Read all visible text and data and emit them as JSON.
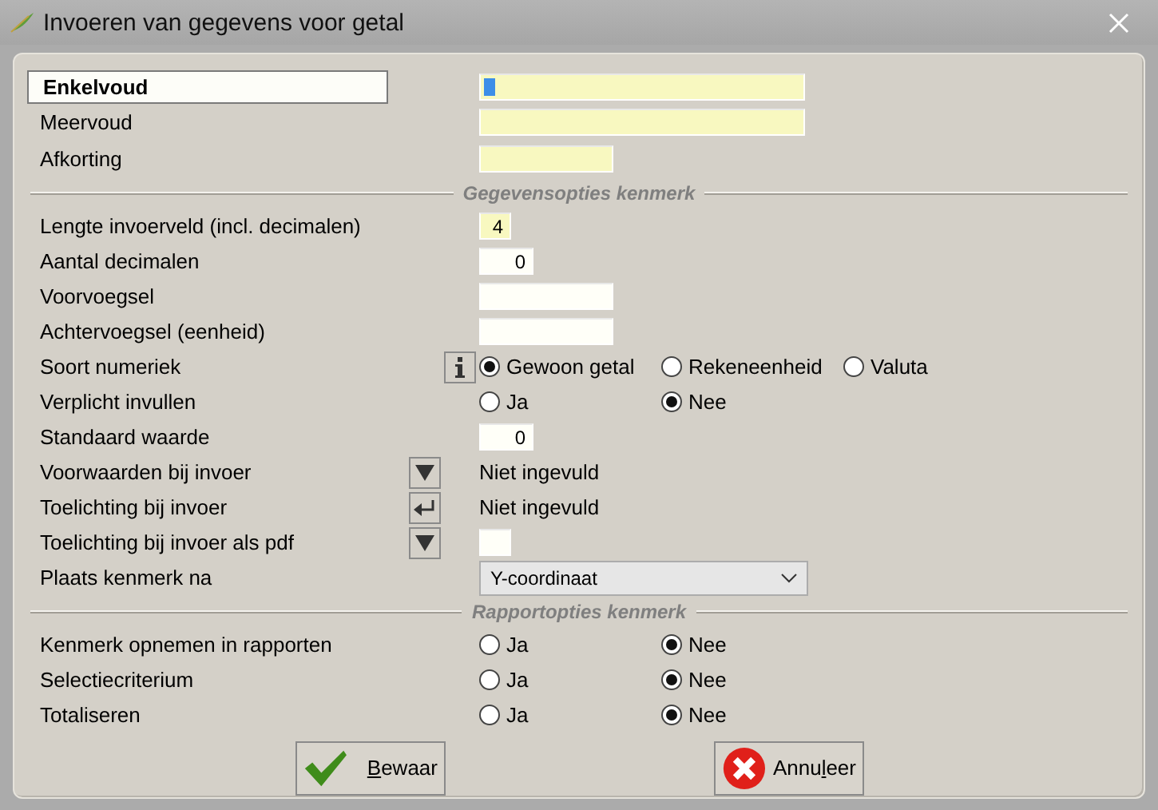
{
  "window": {
    "title": "Invoeren van gegevens voor getal"
  },
  "groups": [
    {
      "rows": [
        {
          "kind": "text",
          "label": "Enkelvoud",
          "focused": true,
          "value": "",
          "highlighted": true
        },
        {
          "kind": "text",
          "label": "Meervoud",
          "focused": false,
          "value": "",
          "highlighted": true
        },
        {
          "kind": "text",
          "label": "Afkorting",
          "focused": false,
          "value": "",
          "highlighted": true
        }
      ]
    },
    {
      "heading": "Gegevensopties kenmerk",
      "rows": [
        {
          "kind": "text",
          "label": "Lengte invoerveld (incl. decimalen)",
          "value": "4",
          "highlighted": true
        },
        {
          "kind": "text",
          "label": "Aantal decimalen",
          "value": "0",
          "highlighted": false
        },
        {
          "kind": "text",
          "label": "Voorvoegsel",
          "value": "",
          "highlighted": false
        },
        {
          "kind": "text",
          "label": "Achtervoegsel (eenheid)",
          "value": "",
          "highlighted": false
        },
        {
          "kind": "radio",
          "label": "Soort numeriek",
          "button": {
            "kind": "info"
          },
          "options": [
            {
              "label": "Gewoon getal",
              "selected": true
            },
            {
              "label": "Rekeneenheid",
              "selected": false
            },
            {
              "label": "Valuta",
              "selected": false
            }
          ]
        },
        {
          "kind": "radio",
          "label": "Verplicht invullen",
          "options": [
            {
              "label": "Ja",
              "selected": false
            },
            {
              "label": "Nee",
              "selected": true
            }
          ]
        },
        {
          "kind": "text",
          "label": "Standaard waarde",
          "value": "0",
          "highlighted": false
        },
        {
          "kind": "note",
          "label": "Voorwaarden bij invoer",
          "button": {
            "kind": "dropdown"
          },
          "value": "Niet ingevuld"
        },
        {
          "kind": "note",
          "label": "Toelichting bij invoer",
          "button": {
            "kind": "return"
          },
          "value": "Niet ingevuld"
        },
        {
          "kind": "text",
          "label": "Toelichting bij invoer als pdf",
          "button": {
            "kind": "dropdown"
          },
          "value": "",
          "highlighted": false
        },
        {
          "kind": "select",
          "label": "Plaats kenmerk na",
          "value": "Y-coordinaat"
        }
      ]
    },
    {
      "heading": "Rapportopties kenmerk",
      "rows": [
        {
          "kind": "radio",
          "label": "Kenmerk opnemen in rapporten",
          "options": [
            {
              "label": "Ja",
              "selected": false
            },
            {
              "label": "Nee",
              "selected": true
            }
          ]
        },
        {
          "kind": "radio",
          "label": "Selectiecriterium",
          "options": [
            {
              "label": "Ja",
              "selected": false
            },
            {
              "label": "Nee",
              "selected": true
            }
          ]
        },
        {
          "kind": "radio",
          "label": "Totaliseren",
          "options": [
            {
              "label": "Ja",
              "selected": false
            },
            {
              "label": "Nee",
              "selected": true
            }
          ]
        }
      ]
    }
  ],
  "buttons": [
    {
      "kind": "save",
      "label": [
        {
          "text": "B",
          "underlined": true
        },
        {
          "text": "ewaar",
          "underlined": false
        }
      ]
    },
    {
      "kind": "cancel",
      "label": [
        {
          "text": "Annu",
          "underlined": false
        },
        {
          "text": "l",
          "underlined": true
        },
        {
          "text": "eer",
          "underlined": false
        }
      ]
    }
  ]
}
